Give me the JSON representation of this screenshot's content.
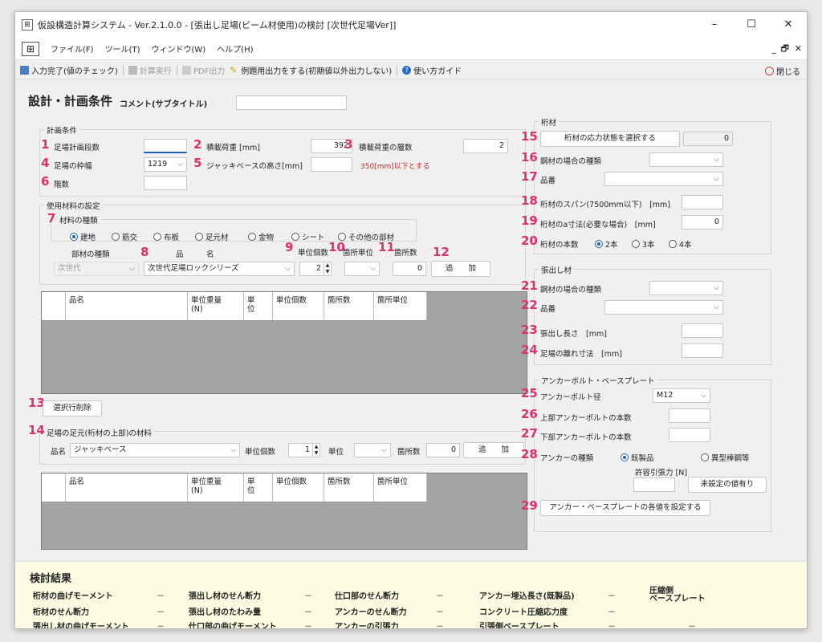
{
  "window": {
    "title": "仮設構造計算システム - Ver.2.1.0.0 - [張出し足場(ビーム材使用)の検討 [次世代足場Ver]]"
  },
  "menu": [
    "ファイル(F)",
    "ツール(T)",
    "ウィンドウ(W)",
    "ヘルプ(H)"
  ],
  "toolbar": {
    "check": "入力完了(値のチェック)",
    "calc": "計算実行",
    "pdf": "PDF出力",
    "example": "例題用出力をする(初期値以外出力しない)",
    "guide": "使い方ガイド",
    "close": "閉じる"
  },
  "heading": {
    "title": "設計・計画条件",
    "comment_label": "コメント(サブタイトル)",
    "comment_value": ""
  },
  "keikaku": {
    "group_title": "計画条件",
    "n1": "1",
    "step_label": "足場計画段数",
    "step_value": "",
    "n2": "2",
    "load_label": "積載荷重 [mm]",
    "load_value": "392",
    "n3": "3",
    "layers_label": "積載荷重の層数",
    "layers_value": "2",
    "n4": "4",
    "width_label": "足場の枠幅",
    "width_value": "1219",
    "n5": "5",
    "jack_label": "ジャッキベースの高さ[mm]",
    "jack_value": "",
    "jack_note": "350[mm]以下とする",
    "n6": "6",
    "floors_label": "階数",
    "floors_value": ""
  },
  "materials": {
    "group_title": "使用材料の設定",
    "n7": "7",
    "kind_title": "材料の種類",
    "kinds": [
      "建地",
      "筋交",
      "布板",
      "足元材",
      "金物",
      "シート",
      "その他の部材"
    ],
    "col_kind": "部材の種類",
    "col_item": "品　　　名",
    "n8": "8",
    "n9": "9",
    "n10": "10",
    "n11": "11",
    "n12": "12",
    "col_unit_count": "単位個数",
    "col_place_unit": "箇所単位",
    "col_places": "箇所数",
    "kind_value": "次世代",
    "item_value": "次世代足場ロックシリーズ",
    "unit_count_value": "2",
    "places_value": "0",
    "add_label": "追　　加"
  },
  "grid_headers": [
    "品名",
    "単位重量\n(N)",
    "単\n位",
    "単位個数",
    "箇所数",
    "箇所単位"
  ],
  "delete": {
    "n13": "13",
    "label": "選択行削除"
  },
  "base": {
    "n14": "14",
    "title": "足場の足元(桁材の上部)の材料",
    "item_label": "品名",
    "item_value": "ジャッキベース",
    "unit_count_label": "単位個数",
    "unit_count_value": "1",
    "unit_label": "単位",
    "places_label": "箇所数",
    "places_value": "0",
    "add_label": "追　　加"
  },
  "girder": {
    "group_title": "桁材",
    "n15": "15",
    "stress_button": "桁材の応力状態を選択する",
    "stress_value": "0",
    "n16": "16",
    "steel_kind_label": "鋼材の場合の種類",
    "n17": "17",
    "part_label": "品番",
    "n18": "18",
    "span_label": "桁材のスパン(7500mm以下)　[mm]",
    "span_value": "",
    "n19": "19",
    "a_label": "桁材のa寸法(必要な場合)　[mm]",
    "a_value": "0",
    "n20": "20",
    "count_label": "桁材の本数",
    "count_options": [
      "2本",
      "3本",
      "4本"
    ]
  },
  "overhang": {
    "group_title": "張出し材",
    "n21": "21",
    "steel_kind_label": "鋼材の場合の種類",
    "n22": "22",
    "part_label": "品番",
    "n23": "23",
    "length_label": "張出し長さ　[mm]",
    "n24": "24",
    "gap_label": "足場の離れ寸法　[mm]"
  },
  "anchor": {
    "group_title": "アンカーボルト・ベースプレート",
    "n25": "25",
    "dia_label": "アンカーボルト径",
    "dia_value": "M12",
    "n26": "26",
    "upper_label": "上部アンカーボルトの本数",
    "n27": "27",
    "lower_label": "下部アンカーボルトの本数",
    "n28": "28",
    "type_label": "アンカーの種類",
    "type_options": [
      "既製品",
      "異型棒鋼等"
    ],
    "allow_label": "許容引張力 [N]",
    "unset_button": "未設定の値有り",
    "n29": "29",
    "set_button": "アンカー・ベースプレートの各値を設定する"
  },
  "results": {
    "title": "検討結果",
    "items": [
      "桁材の曲げモーメント",
      "張出し材のせん断力",
      "仕口部のせん断力",
      "アンカー埋込長さ(既製品)",
      "桁材のせん断力",
      "張出し材のたわみ量",
      "アンカーのせん断力",
      "コンクリート圧縮応力度",
      "張出し材の曲げモーメント",
      "仕口部の曲げモーメント",
      "アンカーの引張力",
      "引張側ベースプレート"
    ],
    "dash": "－",
    "compress_label": "圧縮側\nベースプレート"
  }
}
